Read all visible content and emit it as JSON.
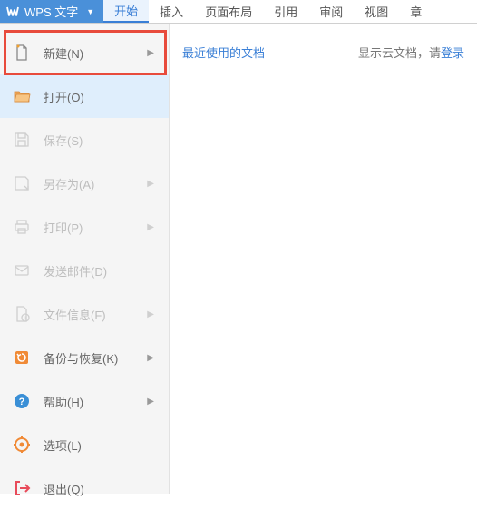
{
  "header": {
    "app_name": "WPS 文字",
    "tabs": [
      {
        "label": "开始",
        "active": true
      },
      {
        "label": "插入"
      },
      {
        "label": "页面布局"
      },
      {
        "label": "引用"
      },
      {
        "label": "审阅"
      },
      {
        "label": "视图"
      },
      {
        "label": "章"
      }
    ]
  },
  "sidebar": {
    "items": [
      {
        "label": "新建(N)",
        "icon": "file-new",
        "chevron": true,
        "disabled": false,
        "highlighted": true
      },
      {
        "label": "打开(O)",
        "icon": "folder-open",
        "chevron": false,
        "disabled": false,
        "selected": true
      },
      {
        "label": "保存(S)",
        "icon": "save",
        "chevron": false,
        "disabled": true
      },
      {
        "label": "另存为(A)",
        "icon": "save-as",
        "chevron": true,
        "disabled": true
      },
      {
        "label": "打印(P)",
        "icon": "print",
        "chevron": true,
        "disabled": true
      },
      {
        "label": "发送邮件(D)",
        "icon": "mail",
        "chevron": false,
        "disabled": true
      },
      {
        "label": "文件信息(F)",
        "icon": "file-info",
        "chevron": true,
        "disabled": true
      },
      {
        "label": "备份与恢复(K)",
        "icon": "backup",
        "chevron": true,
        "disabled": false,
        "accent": "#f08a36"
      },
      {
        "label": "帮助(H)",
        "icon": "help",
        "chevron": true,
        "disabled": false,
        "accent": "#3a8fd6"
      },
      {
        "label": "选项(L)",
        "icon": "settings",
        "chevron": false,
        "disabled": false,
        "accent": "#f08a36"
      },
      {
        "label": "退出(Q)",
        "icon": "exit",
        "chevron": false,
        "disabled": false,
        "accent": "#e84b5a"
      }
    ]
  },
  "content": {
    "recent_title": "最近使用的文档",
    "cloud_prefix": "显示云文档，请",
    "cloud_login": "登录"
  }
}
